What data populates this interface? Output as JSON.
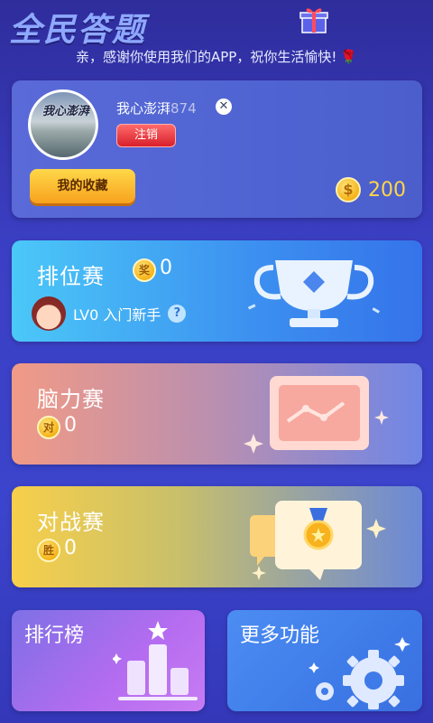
{
  "app": {
    "title": "全民答题",
    "greeting": "亲，感谢你使用我们的APP，祝你生活愉快!",
    "greeting_emoji": "🌹"
  },
  "profile": {
    "avatar_text": "我心澎湃",
    "username": "我心澎湃",
    "user_id": "874",
    "logout_label": "注销",
    "favorites_label": "我的收藏",
    "coin_symbol": "$",
    "coins": "200"
  },
  "modes": {
    "rank": {
      "title": "排位赛",
      "medal_char": "奖",
      "medal_value": "0",
      "level_text": "LV0 入门新手",
      "help_char": "?"
    },
    "brain": {
      "title": "脑力赛",
      "medal_char": "对",
      "medal_value": "0"
    },
    "battle": {
      "title": "对战赛",
      "medal_char": "胜",
      "medal_value": "0"
    }
  },
  "bottom": {
    "leaderboard_label": "排行榜",
    "more_label": "更多功能"
  },
  "colors": {
    "background": "#3b3fc4",
    "coin": "#ffd54a",
    "logout": "#d71f2a",
    "favorites": "#f7a21d"
  }
}
